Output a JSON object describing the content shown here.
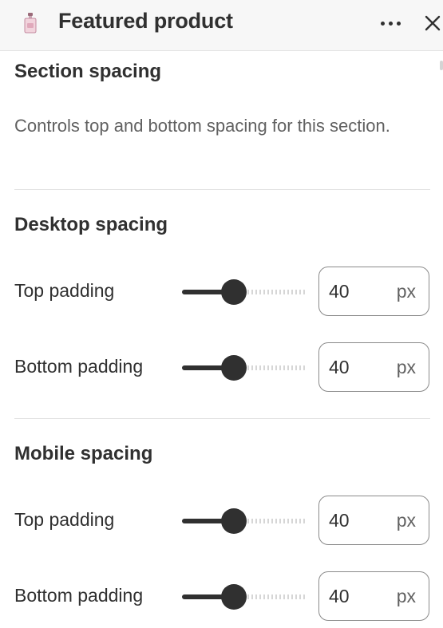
{
  "header": {
    "title": "Featured product",
    "thumbnail_icon": "perfume-bottle-icon",
    "more_icon": "more-horizontal-icon",
    "close_icon": "close-icon"
  },
  "section": {
    "title": "Section spacing",
    "description": "Controls top and bottom spacing for this section."
  },
  "desktop": {
    "title": "Desktop spacing",
    "top": {
      "label": "Top padding",
      "value": "40",
      "unit": "px"
    },
    "bottom": {
      "label": "Bottom padding",
      "value": "40",
      "unit": "px"
    }
  },
  "mobile": {
    "title": "Mobile spacing",
    "top": {
      "label": "Top padding",
      "value": "40",
      "unit": "px"
    },
    "bottom": {
      "label": "Bottom padding",
      "value": "40",
      "unit": "px"
    }
  },
  "colors": {
    "text": "#303030",
    "muted": "#616161",
    "header_bg": "#f7f7f7",
    "divider": "#e3e3e3"
  }
}
